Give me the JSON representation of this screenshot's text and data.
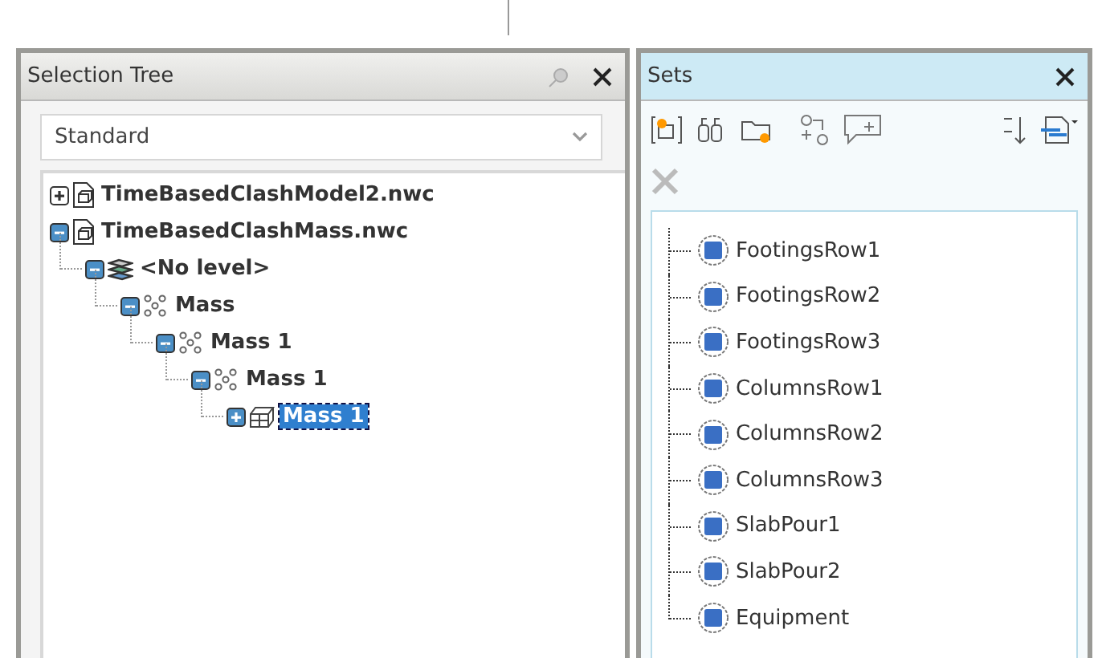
{
  "selection_tree": {
    "title": "Selection Tree",
    "dropdown": {
      "value": "Standard"
    },
    "items": [
      {
        "label": "TimeBasedClashModel2.nwc",
        "kind": "file",
        "expanded": false,
        "selected": false
      },
      {
        "label": "TimeBasedClashMass.nwc",
        "kind": "file",
        "expanded": true,
        "selected": false,
        "children": [
          {
            "label": "<No level>",
            "kind": "layer",
            "expanded": true,
            "selected": false,
            "children": [
              {
                "label": "Mass",
                "kind": "group",
                "expanded": true,
                "selected": false,
                "children": [
                  {
                    "label": "Mass 1",
                    "kind": "group",
                    "expanded": true,
                    "selected": false,
                    "children": [
                      {
                        "label": "Mass 1",
                        "kind": "group",
                        "expanded": true,
                        "selected": false,
                        "children": [
                          {
                            "label": "Mass 1",
                            "kind": "geometry",
                            "expanded": false,
                            "selected": true
                          }
                        ]
                      }
                    ]
                  }
                ]
              }
            ]
          }
        ]
      }
    ]
  },
  "sets": {
    "title": "Sets",
    "items": [
      {
        "label": "FootingsRow1"
      },
      {
        "label": "FootingsRow2"
      },
      {
        "label": "FootingsRow3"
      },
      {
        "label": "ColumnsRow1"
      },
      {
        "label": "ColumnsRow2"
      },
      {
        "label": "ColumnsRow3"
      },
      {
        "label": "SlabPour1"
      },
      {
        "label": "SlabPour2"
      },
      {
        "label": "Equipment"
      }
    ]
  }
}
